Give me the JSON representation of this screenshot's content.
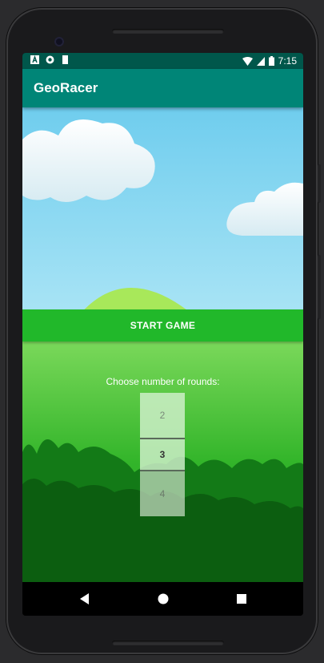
{
  "status_bar": {
    "time": "7:15",
    "left_icons": [
      "a-box-icon",
      "circle-notification-icon",
      "sd-card-icon"
    ],
    "right_icons": [
      "wifi-icon",
      "signal-icon",
      "battery-icon"
    ]
  },
  "app_bar": {
    "title": "GeoRacer"
  },
  "main": {
    "start_button": "START GAME",
    "rounds_label": "Choose number of rounds:",
    "picker": {
      "previous": "2",
      "selected": "3",
      "next": "4"
    }
  },
  "nav_bar": {
    "icons": [
      "back-icon",
      "home-icon",
      "recents-icon"
    ]
  },
  "colors": {
    "status_bar": "#00574b",
    "app_bar": "#008577",
    "button": "#21b82a",
    "sky": "#8ad8f0",
    "grass": "#24b12b",
    "bushes": "#0e6a12"
  }
}
